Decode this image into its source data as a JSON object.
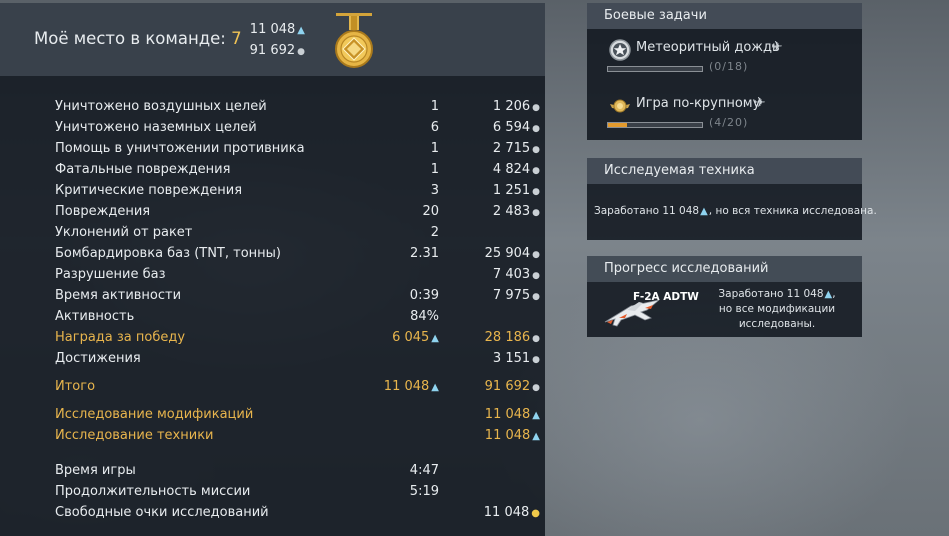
{
  "header": {
    "place_label": "Моё место в команде:",
    "place_value": "7",
    "rp_total": "11 048",
    "sl_total": "91 692"
  },
  "stats": [
    {
      "label": "Уничтожено воздушных целей",
      "count": "1",
      "reward": "1 206",
      "icon": "silver-lion-icon"
    },
    {
      "label": "Уничтожено наземных целей",
      "count": "6",
      "reward": "6 594",
      "icon": "silver-lion-icon"
    },
    {
      "label": "Помощь в уничтожении противника",
      "count": "1",
      "reward": "2 715",
      "icon": "silver-lion-icon"
    },
    {
      "label": "Фатальные повреждения",
      "count": "1",
      "reward": "4 824",
      "icon": "silver-lion-icon"
    },
    {
      "label": "Критические повреждения",
      "count": "3",
      "reward": "1 251",
      "icon": "silver-lion-icon"
    },
    {
      "label": "Повреждения",
      "count": "20",
      "reward": "2 483",
      "icon": "silver-lion-icon"
    },
    {
      "label": "Уклонений от ракет",
      "count": "2",
      "reward": "",
      "icon": ""
    },
    {
      "label": "Бомбардировка баз (TNT, тонны)",
      "count": "2.31",
      "reward": "25 904",
      "icon": "silver-lion-icon"
    },
    {
      "label": "Разрушение баз",
      "count": "",
      "reward": "7 403",
      "icon": "silver-lion-icon"
    },
    {
      "label": "Время активности",
      "count": "0:39",
      "reward": "7 975",
      "icon": "silver-lion-icon"
    },
    {
      "label": "Активность",
      "count": "84%",
      "reward": "",
      "icon": ""
    },
    {
      "label": "Награда за победу",
      "count": "6 045",
      "reward": "28 186",
      "icon": "silver-lion-icon",
      "gold": true
    },
    {
      "label": "Достижения",
      "count": "",
      "reward": "3 151",
      "icon": "silver-lion-icon"
    },
    {
      "label": "Итого",
      "count": "11 048",
      "reward": "91 692",
      "icon": "silver-lion-icon",
      "gold": true
    },
    {
      "label": "Исследование модификаций",
      "count": "",
      "reward": "11 048",
      "icon": "research-point-icon",
      "gold": true
    },
    {
      "label": "Исследование техники",
      "count": "",
      "reward": "11 048",
      "icon": "research-point-icon",
      "gold": true
    },
    {
      "label": "Время игры",
      "count": "4:47",
      "reward": "",
      "icon": ""
    },
    {
      "label": "Продолжительность миссии",
      "count": "5:19",
      "reward": "",
      "icon": ""
    },
    {
      "label": "Свободные очки исследований",
      "count": "",
      "reward": "11 048",
      "icon": "free-research-icon"
    }
  ],
  "tasks_panel": {
    "title": "Боевые задачи",
    "tasks": [
      {
        "name": "Метеоритный дождь",
        "progress": "(0/18)",
        "fraction": 0.0,
        "icon": "star-badge-icon"
      },
      {
        "name": "Игра по-крупному",
        "progress": "(4/20)",
        "fraction": 0.2,
        "icon": "winged-badge-icon"
      }
    ]
  },
  "research_tech_panel": {
    "title": "Исследуемая техника",
    "note_prefix": "Заработано 11 048",
    "note_suffix": ", но вся техника исследована."
  },
  "research_progress_panel": {
    "title": "Прогресс исследований",
    "vehicle": "F-2A ADTW",
    "note_line1_prefix": "Заработано 11 048",
    "note_line2": "но все модификации",
    "note_line3": "исследованы."
  },
  "colors": {
    "gold_text": "#e8b54d",
    "place_value": "#f0c355",
    "progress_fill": "#e39a2d",
    "rp_icon": "#8fd3ef"
  }
}
